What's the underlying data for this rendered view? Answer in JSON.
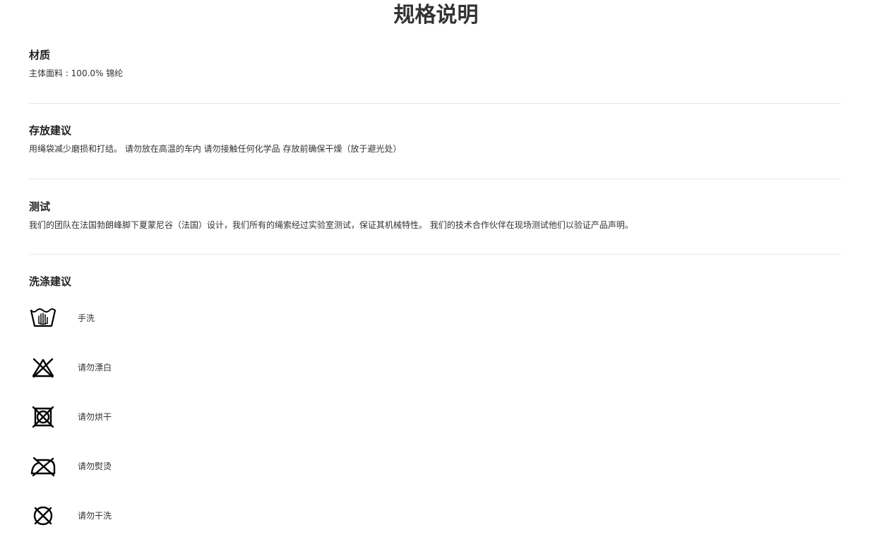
{
  "page": {
    "title": "规格说明"
  },
  "sections": {
    "material": {
      "heading": "材质",
      "body": "主体面料 : 100.0% 锦纶"
    },
    "storage": {
      "heading": "存放建议",
      "body": "用绳袋减少磨损和打结。 请勿放在高温的车内 请勿接触任何化学品 存放前确保干燥（放于避光处）"
    },
    "testing": {
      "heading": "测试",
      "body": "我们的团队在法国勃朗峰脚下夏蒙尼谷（法国）设计，我们所有的绳索经过实验室测试，保证其机械特性。 我们的技术合作伙伴在现场测试他们以验证产品声明。"
    },
    "washing": {
      "heading": "洗涤建议",
      "items": [
        {
          "icon": "hand-wash-icon",
          "label": "手洗"
        },
        {
          "icon": "do-not-bleach-icon",
          "label": "请勿漂白"
        },
        {
          "icon": "do-not-tumble-dry-icon",
          "label": "请勿烘干"
        },
        {
          "icon": "do-not-iron-icon",
          "label": "请勿熨烫"
        },
        {
          "icon": "do-not-dry-clean-icon",
          "label": "请勿干洗"
        }
      ]
    }
  }
}
